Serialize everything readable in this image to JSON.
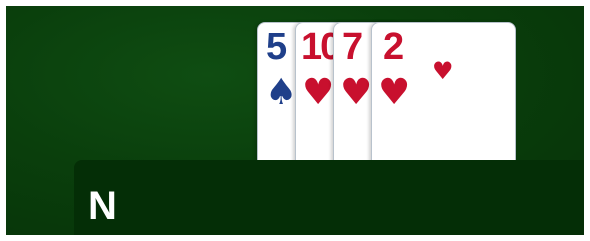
{
  "colors": {
    "felt": "#0a3f0c",
    "panel": "#042e06",
    "red": "#c8102e",
    "blue": "#1f3f8a"
  },
  "hand": {
    "cards": [
      {
        "rank": "5",
        "suit": "♠",
        "suit_name": "spades",
        "color": "#1f3f8a"
      },
      {
        "rank": "10",
        "suit": "♥",
        "suit_name": "hearts",
        "color": "#c8102e"
      },
      {
        "rank": "7",
        "suit": "♥",
        "suit_name": "hearts",
        "color": "#c8102e"
      },
      {
        "rank": "2",
        "suit": "♥",
        "suit_name": "hearts",
        "color": "#c8102e"
      }
    ]
  },
  "panel": {
    "title": "N"
  }
}
